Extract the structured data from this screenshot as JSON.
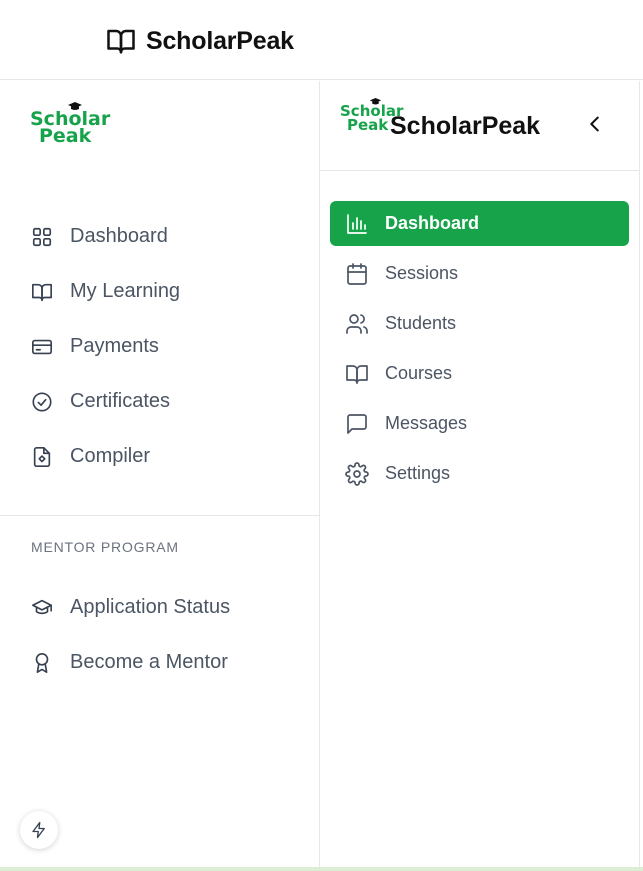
{
  "topbar": {
    "brand": "ScholarPeak",
    "icon": "book-open-icon"
  },
  "left_sidebar": {
    "logo": {
      "line1_a": "Sch",
      "line1_cap": "o",
      "line1_b": "lar",
      "line2": "Peak"
    },
    "nav": [
      {
        "label": "Dashboard",
        "icon": "grid-icon"
      },
      {
        "label": "My Learning",
        "icon": "book-open-icon"
      },
      {
        "label": "Payments",
        "icon": "credit-card-icon"
      },
      {
        "label": "Certificates",
        "icon": "check-circle-icon"
      },
      {
        "label": "Compiler",
        "icon": "file-code-icon"
      }
    ],
    "section_title": "MENTOR PROGRAM",
    "mentor_nav": [
      {
        "label": "Application Status",
        "icon": "graduation-cap-icon"
      },
      {
        "label": "Become a Mentor",
        "icon": "award-icon"
      }
    ],
    "fab_icon": "bolt-icon"
  },
  "right_sidebar": {
    "logo": {
      "line1_a": "Sch",
      "line1_cap": "o",
      "line1_b": "lar",
      "line2": "Peak"
    },
    "title": "ScholarPeak",
    "collapse_icon": "chevron-left-icon",
    "nav": [
      {
        "label": "Dashboard",
        "icon": "bar-chart-icon",
        "active": true
      },
      {
        "label": "Sessions",
        "icon": "calendar-icon",
        "active": false
      },
      {
        "label": "Students",
        "icon": "users-icon",
        "active": false
      },
      {
        "label": "Courses",
        "icon": "book-open-icon",
        "active": false
      },
      {
        "label": "Messages",
        "icon": "message-square-icon",
        "active": false
      },
      {
        "label": "Settings",
        "icon": "gear-icon",
        "active": false
      }
    ]
  },
  "colors": {
    "accent": "#16a34a",
    "text": "#4b5563",
    "heading": "#111111",
    "border": "#e5e7eb"
  }
}
